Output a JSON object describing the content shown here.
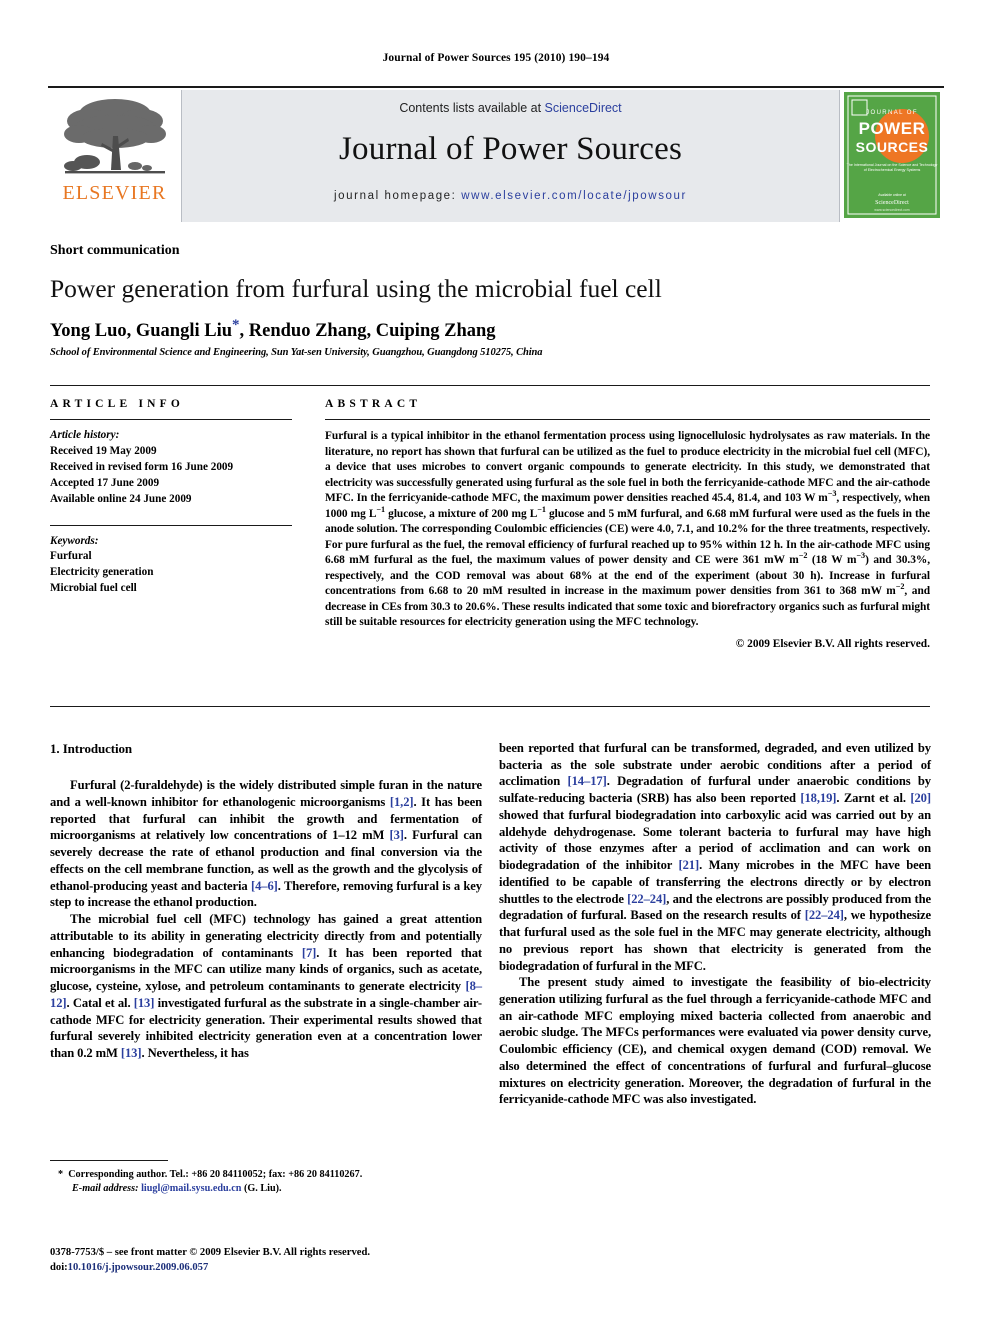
{
  "running_head": "Journal of Power Sources 195 (2010) 190–194",
  "masthead": {
    "contents_prefix": "Contents lists available at ",
    "contents_link": "ScienceDirect",
    "journal_name": "Journal of Power Sources",
    "homepage_prefix": "journal homepage: ",
    "homepage_url": "www.elsevier.com/locate/jpowsour",
    "publisher_wordmark": "ELSEVIER",
    "cover": {
      "line1": "JOURNAL OF",
      "line2": "POWER",
      "line3": "SOURCES",
      "tagline": "The International Journal on the Science and Technology of Electrochemical Energy Systems",
      "imprint": "ELSEVIER"
    },
    "colors": {
      "link": "#2b3f9e",
      "elsevier_orange": "#E87722",
      "banner_bg": "#e7e9ec",
      "cover_green": "#55a546",
      "cover_orange": "#ee7624"
    }
  },
  "article": {
    "doctype": "Short communication",
    "title": "Power generation from furfural using the microbial fuel cell",
    "authors": "Yong Luo, Guangli Liu",
    "corresponding_marker": "*",
    "authors_rest": ", Renduo Zhang, Cuiping Zhang",
    "affiliation": "School of Environmental Science and Engineering, Sun Yat-sen University, Guangzhou, Guangdong 510275, China"
  },
  "article_info": {
    "heading": "ARTICLE INFO",
    "history_label": "Article history:",
    "history": [
      "Received 19 May 2009",
      "Received in revised form 16 June 2009",
      "Accepted 17 June 2009",
      "Available online 24 June 2009"
    ],
    "keywords_label": "Keywords:",
    "keywords": [
      "Furfural",
      "Electricity generation",
      "Microbial fuel cell"
    ]
  },
  "abstract": {
    "heading": "ABSTRACT",
    "paragraph_part1": "Furfural is a typical inhibitor in the ethanol fermentation process using lignocellulosic hydrolysates as raw materials. In the literature, no report has shown that furfural can be utilized as the fuel to produce electricity in the microbial fuel cell (MFC), a device that uses microbes to convert organic compounds to generate electricity. In this study, we demonstrated that electricity was successfully generated using furfural as the sole fuel in both the ferricyanide-cathode MFC and the air-cathode MFC. In the ferricyanide-cathode MFC, the maximum power densities reached 45.4, 81.4, and 103 W m",
    "sup1": "−3",
    "paragraph_part2": ", respectively, when 1000 mg L",
    "sup2": "−1",
    "paragraph_part3": " glucose, a mixture of 200 mg L",
    "sup3": "−1",
    "paragraph_part4": " glucose and 5 mM furfural, and 6.68 mM furfural were used as the fuels in the anode solution. The corresponding Coulombic efficiencies (CE) were 4.0, 7.1, and 10.2% for the three treatments, respectively. For pure furfural as the fuel, the removal efficiency of furfural reached up to 95% within 12 h. In the air-cathode MFC using 6.68 mM furfural as the fuel, the maximum values of power density and CE were 361 mW m",
    "sup4": "−2",
    "paragraph_part5": " (18 W m",
    "sup5": "−3",
    "paragraph_part6": ") and 30.3%, respectively, and the COD removal was about 68% at the end of the experiment (about 30 h). Increase in furfural concentrations from 6.68 to 20 mM resulted in increase in the maximum power densities from 361 to 368 mW m",
    "sup6": "−2",
    "paragraph_part7": ", and decrease in CEs from 30.3 to 20.6%. These results indicated that some toxic and biorefractory organics such as furfural might still be suitable resources for electricity generation using the MFC technology.",
    "copyright": "© 2009 Elsevier B.V. All rights reserved."
  },
  "introduction": {
    "heading": "1.  Introduction",
    "left": {
      "p1_a": "Furfural (2-furaldehyde) is the widely distributed simple furan in the nature and a well-known inhibitor for ethanologenic microorganisms ",
      "p1_ref1": "[1,2]",
      "p1_b": ". It has been reported that furfural can inhibit the growth and fermentation of microorganisms at relatively low concentrations of 1–12 mM ",
      "p1_ref2": "[3]",
      "p1_c": ". Furfural can severely decrease the rate of ethanol production and final conversion via the effects on the cell membrane function, as well as the growth and the glycolysis of ethanol-producing yeast and bacteria ",
      "p1_ref3": "[4–6]",
      "p1_d": ". Therefore, removing furfural is a key step to increase the ethanol production.",
      "p2_a": "The microbial fuel cell (MFC) technology has gained a great attention attributable to its ability in generating electricity directly from and potentially enhancing biodegradation of contaminants ",
      "p2_ref1": "[7]",
      "p2_b": ". It has been reported that microorganisms in the MFC can utilize many kinds of organics, such as acetate, glucose, cysteine, xylose, and petroleum contaminants to generate electricity ",
      "p2_ref2": "[8–12]",
      "p2_c": ". Catal et al. ",
      "p2_ref3": "[13]",
      "p2_d": " investigated furfural as the substrate in a single-chamber air-cathode MFC for electricity generation. Their experimental results showed that furfural severely inhibited electricity generation even at a concentration lower than 0.2 mM ",
      "p2_ref4": "[13]",
      "p2_e": ". Nevertheless, it has"
    },
    "right": {
      "p2_cont_a": "been reported that furfural can be transformed, degraded, and even utilized by bacteria as the sole substrate under aerobic conditions after a period of acclimation ",
      "p2_cont_ref1": "[14–17]",
      "p2_cont_b": ". Degradation of furfural under anaerobic conditions by sulfate-reducing bacteria (SRB) has also been reported ",
      "p2_cont_ref2": "[18,19]",
      "p2_cont_c": ". Zarnt et al. ",
      "p2_cont_ref3": "[20]",
      "p2_cont_d": " showed that furfural biodegradation into carboxylic acid was carried out by an aldehyde dehydrogenase. Some tolerant bacteria to furfural may have high activity of those enzymes after a period of acclimation and can work on biodegradation of the inhibitor ",
      "p2_cont_ref4": "[21]",
      "p2_cont_e": ". Many microbes in the MFC have been identified to be capable of transferring the electrons directly or by electron shuttles to the electrode ",
      "p2_cont_ref5": "[22–24]",
      "p2_cont_f": ", and the electrons are possibly produced from the degradation of furfural. Based on the research results of ",
      "p2_cont_ref6": "[22–24]",
      "p2_cont_g": ", we hypothesize that furfural used as the sole fuel in the MFC may generate electricity, although no previous report has shown that electricity is generated from the biodegradation of furfural in the MFC.",
      "p3": "The present study aimed to investigate the feasibility of bio-electricity generation utilizing furfural as the fuel through a ferricyanide-cathode MFC and an air-cathode MFC employing mixed bacteria collected from anaerobic and aerobic sludge. The MFCs performances were evaluated via power density curve, Coulombic efficiency (CE), and chemical oxygen demand (COD) removal. We also determined the effect of concentrations of furfural and furfural–glucose mixtures on electricity generation. Moreover, the degradation of furfural in the ferricyanide-cathode MFC was also investigated."
    }
  },
  "footnote": {
    "marker": "*",
    "text_a": "Corresponding author. Tel.: +86 20 84110052; fax: +86 20 84110267.",
    "email_label": "E-mail address:",
    "email": "liugl@mail.sysu.edu.cn",
    "email_owner": "(G. Liu)."
  },
  "footer": {
    "line1": "0378-7753/$ – see front matter © 2009 Elsevier B.V. All rights reserved.",
    "doi_label": "doi:",
    "doi_value": "10.1016/j.jpowsour.2009.06.057"
  }
}
